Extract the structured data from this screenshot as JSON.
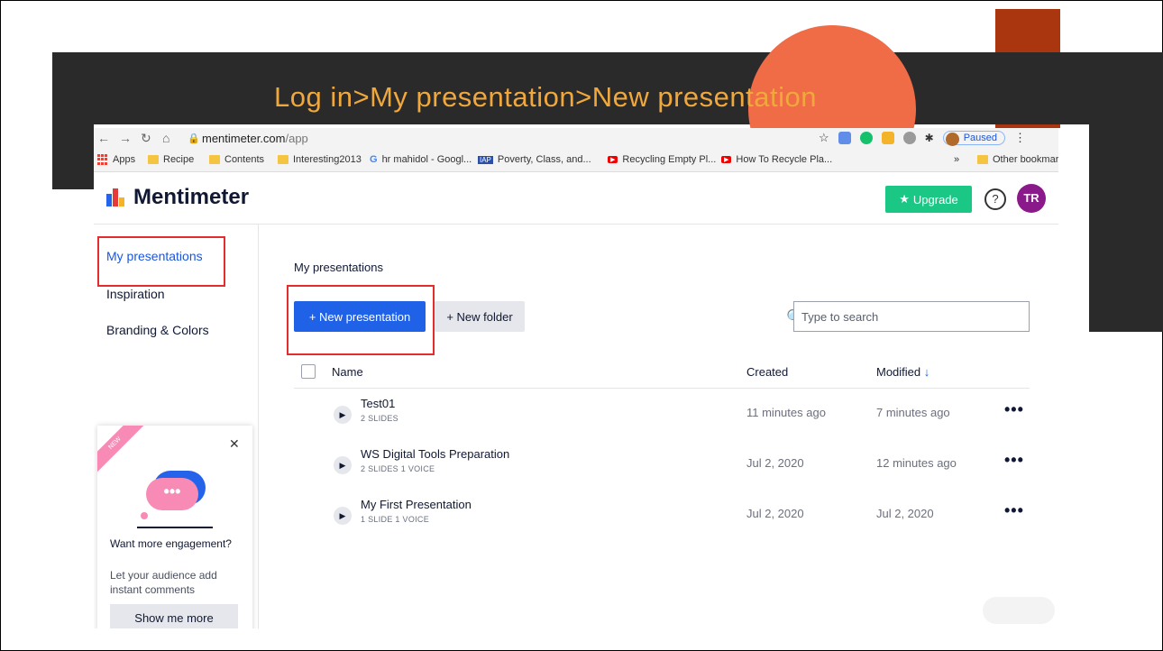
{
  "slide": {
    "title": "Log in>My presentation>New presentation"
  },
  "browser": {
    "url_domain": "mentimeter.com",
    "url_path": "/app",
    "paused_label": "Paused",
    "bookmarks": [
      {
        "label": "Apps"
      },
      {
        "label": "Recipe"
      },
      {
        "label": "Contents"
      },
      {
        "label": "Interesting2013"
      },
      {
        "label": "hr mahidol - Googl..."
      },
      {
        "label": "Poverty, Class, and..."
      },
      {
        "label": "Recycling Empty Pl..."
      },
      {
        "label": "How To Recycle Pla..."
      }
    ],
    "more": "»",
    "other_bookmarks": "Other bookmarks"
  },
  "app": {
    "logo": "Mentimeter",
    "upgrade": "Upgrade",
    "help": "?",
    "avatar_initials": "TR"
  },
  "sidebar": {
    "items": [
      {
        "label": "My presentations"
      },
      {
        "label": "Inspiration"
      },
      {
        "label": "Branding & Colors"
      }
    ]
  },
  "main": {
    "heading": "My presentations",
    "new_presentation": "+ New presentation",
    "new_folder": "+ New folder",
    "search_placeholder": "Type to search",
    "columns": {
      "name": "Name",
      "created": "Created",
      "modified": "Modified"
    },
    "rows": [
      {
        "title": "Test01",
        "meta": "2 SLIDES",
        "created": "11 minutes ago",
        "modified": "7 minutes ago"
      },
      {
        "title": "WS Digital Tools Preparation",
        "meta": "2 SLIDES   1 VOICE",
        "created": "Jul 2, 2020",
        "modified": "12 minutes ago"
      },
      {
        "title": "My First Presentation",
        "meta": "1 SLIDE   1 VOICE",
        "created": "Jul 2, 2020",
        "modified": "Jul 2, 2020"
      }
    ]
  },
  "promo": {
    "ribbon": "NEW",
    "title": "Want more engagement?",
    "text": "Let your audience add instant comments",
    "button": "Show me more"
  },
  "colors": {
    "accent": "#1f62e8",
    "upgrade": "#1bc785",
    "highlight": "#e32c2c",
    "slide_title": "#f0a83c"
  }
}
